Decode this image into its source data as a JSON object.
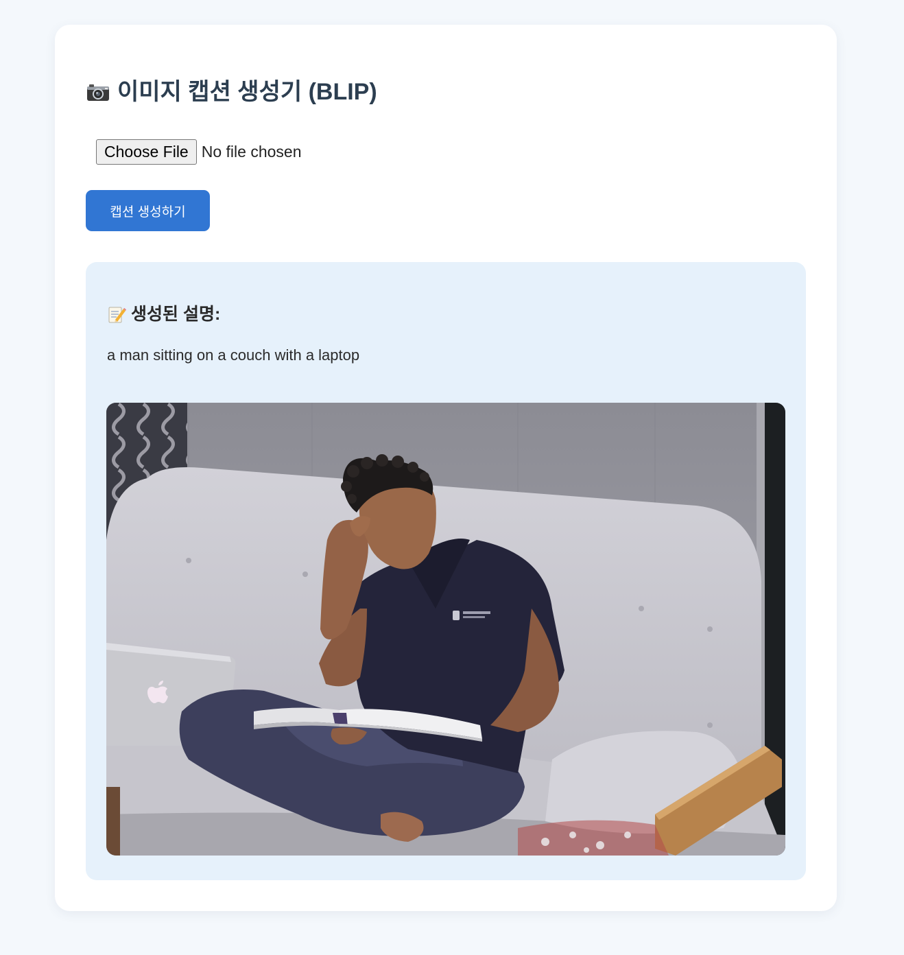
{
  "header": {
    "title_icon": "camera-icon",
    "title": "이미지 캡션 생성기 (BLIP)"
  },
  "upload": {
    "choose_file_label": "Choose File",
    "file_status": "No file chosen"
  },
  "actions": {
    "generate_label": "캡션 생성하기"
  },
  "result": {
    "heading_icon": "memo-icon",
    "heading": "생성된 설명:",
    "caption": "a man sitting on a couch with a laptop"
  },
  "colors": {
    "page_bg": "#f4f8fc",
    "card_bg": "#ffffff",
    "accent": "#3176d3",
    "result_bg": "#e6f1fb",
    "title_text": "#2c3e50"
  }
}
